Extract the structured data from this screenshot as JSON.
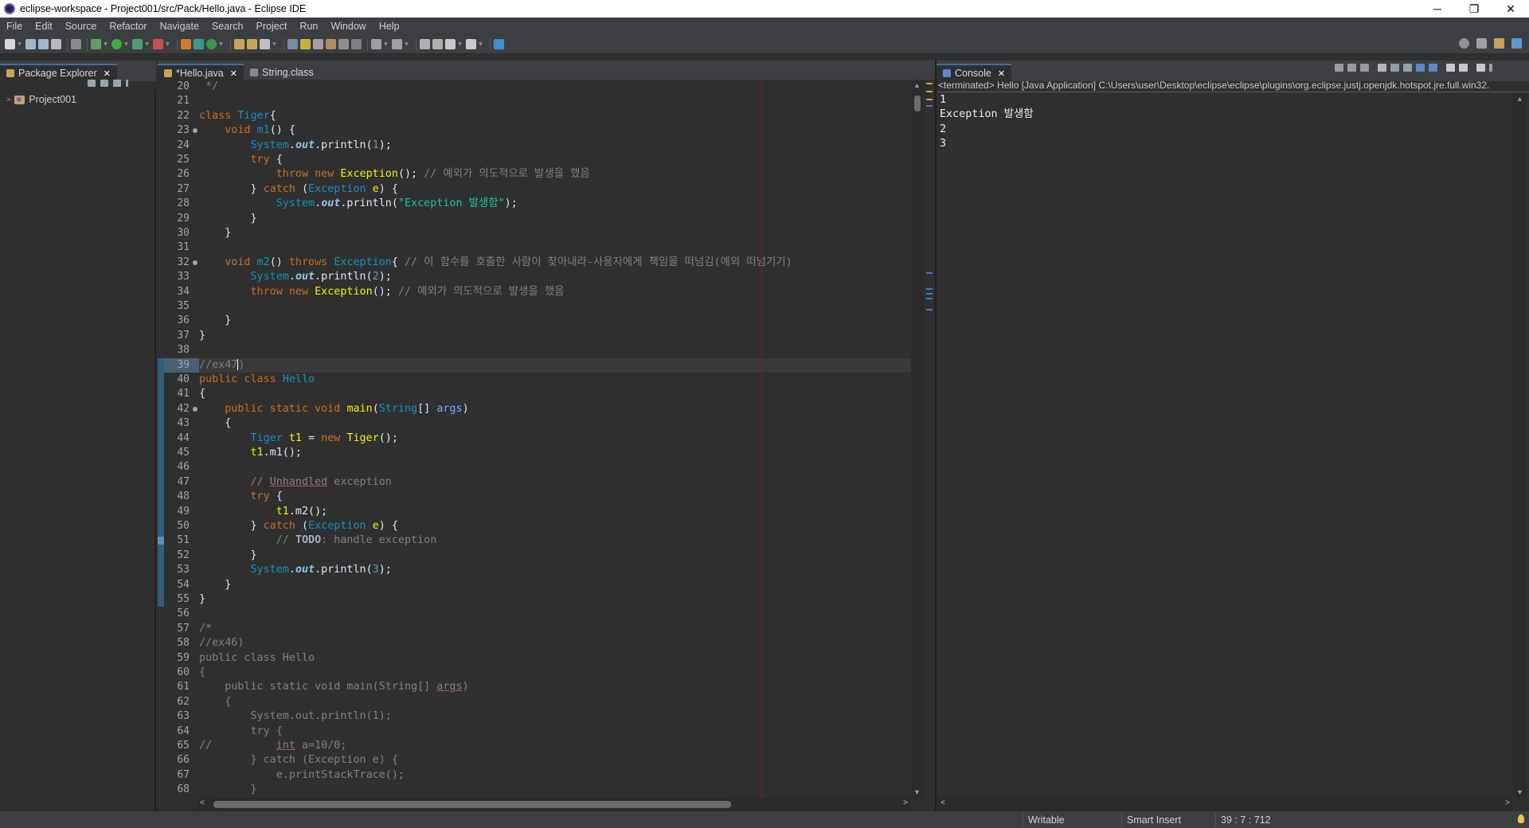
{
  "window": {
    "title": "eclipse-workspace - Project001/src/Pack/Hello.java - Eclipse IDE",
    "controls": {
      "minimize": "─",
      "restore": "❐",
      "close": "✕"
    }
  },
  "menu": [
    "File",
    "Edit",
    "Source",
    "Refactor",
    "Navigate",
    "Search",
    "Project",
    "Run",
    "Window",
    "Help"
  ],
  "package_explorer": {
    "tab_label": "Package Explorer",
    "project": "Project001"
  },
  "editor": {
    "tabs": [
      {
        "label": "*Hello.java",
        "active": true
      },
      {
        "label": "String.class",
        "active": false
      }
    ],
    "cursor_line": "39",
    "lines": [
      {
        "n": "20",
        "html": "<span class=\"cm\"> */</span>"
      },
      {
        "n": "21",
        "html": ""
      },
      {
        "n": "22",
        "html": "<span class=\"kw\">class</span> <span class=\"ty\">Tiger</span>{"
      },
      {
        "n": "23",
        "fold": true,
        "html": "    <span class=\"kw\">void</span> <span class=\"ty\">m1</span>() {"
      },
      {
        "n": "24",
        "html": "        <span class=\"ty\">System</span>.<span class=\"fld\">out</span>.println(<span class=\"num\">1</span>);"
      },
      {
        "n": "25",
        "html": "        <span class=\"kw\">try</span> {"
      },
      {
        "n": "26",
        "html": "            <span class=\"kw\">throw</span> <span class=\"kw\">new</span> <span class=\"var\">Exception</span>(); <span class=\"cm\">// 예외가 의도적으로 발생을 했음</span>"
      },
      {
        "n": "27",
        "html": "        } <span class=\"kw\">catch</span> (<span class=\"ty\">Exception</span> <span class=\"var\">e</span>) {"
      },
      {
        "n": "28",
        "html": "            <span class=\"ty\">System</span>.<span class=\"fld\">out</span>.println(<span class=\"str\">\"Exception 발생함\"</span>);"
      },
      {
        "n": "29",
        "html": "        }"
      },
      {
        "n": "30",
        "html": "    }"
      },
      {
        "n": "31",
        "html": ""
      },
      {
        "n": "32",
        "fold": true,
        "html": "    <span class=\"kw\">void</span> <span class=\"ty\">m2</span>() <span class=\"kw\">throws</span> <span class=\"ty\">Exception</span>{ <span class=\"cm\">// 이 함수를 호출한 사람이 찾아내라-사용자에게 책임을 떠넘김(예외 떠넘기기)</span>"
      },
      {
        "n": "33",
        "html": "        <span class=\"ty\">System</span>.<span class=\"fld\">out</span>.println(<span class=\"num\">2</span>);"
      },
      {
        "n": "34",
        "html": "        <span class=\"kw\">throw</span> <span class=\"kw\">new</span> <span class=\"var\">Exception</span>(); <span class=\"cm\">// 예외가 의도적으로 발생을 했음</span>"
      },
      {
        "n": "35",
        "html": ""
      },
      {
        "n": "36",
        "html": "    }"
      },
      {
        "n": "37",
        "html": "}"
      },
      {
        "n": "38",
        "html": ""
      },
      {
        "n": "39",
        "current": true,
        "html": "<span class=\"cm\">//ex47<span class=\"caret\"></span>)</span>"
      },
      {
        "n": "40",
        "html": "<span class=\"kw\">public</span> <span class=\"kw\">class</span> <span class=\"ty\">Hello</span>"
      },
      {
        "n": "41",
        "html": "{"
      },
      {
        "n": "42",
        "fold": true,
        "html": "    <span class=\"kw\">public</span> <span class=\"kw\">static</span> <span class=\"kw\">void</span> <span class=\"var\">main</span>(<span class=\"ty\">String</span>[] <span class=\"par\">args</span>)"
      },
      {
        "n": "43",
        "html": "    {"
      },
      {
        "n": "44",
        "html": "        <span class=\"ty\">Tiger</span> <span class=\"var\">t1</span> = <span class=\"kw\">new</span> <span class=\"var\">Tiger</span>();"
      },
      {
        "n": "45",
        "html": "        <span class=\"var\">t1</span>.m1();"
      },
      {
        "n": "46",
        "html": ""
      },
      {
        "n": "47",
        "html": "        <span class=\"cm\">// <span class=\"ul\">Unhandled</span> exception</span>"
      },
      {
        "n": "48",
        "html": "        <span class=\"kw\">try</span> {"
      },
      {
        "n": "49",
        "html": "            <span class=\"var\">t1</span>.m2();"
      },
      {
        "n": "50",
        "html": "        } <span class=\"kw\">catch</span> (<span class=\"ty\">Exception</span> <span class=\"var\">e</span>) {"
      },
      {
        "n": "51",
        "task": true,
        "html": "            <span class=\"cm\">// <span class=\"todo\">TODO</span>: handle exception</span>"
      },
      {
        "n": "52",
        "html": "        }"
      },
      {
        "n": "53",
        "html": "        <span class=\"ty\">System</span>.<span class=\"fld\">out</span>.println(<span class=\"num\">3</span>);"
      },
      {
        "n": "54",
        "html": "    }"
      },
      {
        "n": "55",
        "html": "}"
      },
      {
        "n": "56",
        "html": ""
      },
      {
        "n": "57",
        "html": "<span class=\"cm\">/*</span>"
      },
      {
        "n": "58",
        "html": "<span class=\"cm\">//ex46)</span>"
      },
      {
        "n": "59",
        "html": "<span class=\"cm\">public class Hello</span>"
      },
      {
        "n": "60",
        "html": "<span class=\"cm\">{</span>"
      },
      {
        "n": "61",
        "html": "<span class=\"cm\">    public static void main(String[] <span class=\"ul\">args</span>)</span>"
      },
      {
        "n": "62",
        "html": "<span class=\"cm\">    {</span>"
      },
      {
        "n": "63",
        "html": "<span class=\"cm\">        System.out.println(1);</span>"
      },
      {
        "n": "64",
        "html": "<span class=\"cm\">        try {</span>"
      },
      {
        "n": "65",
        "html": "<span class=\"cm\">//          <span class=\"ul\">int</span> a=10/0;</span>"
      },
      {
        "n": "66",
        "html": "<span class=\"cm\">        } catch (Exception e) {</span>"
      },
      {
        "n": "67",
        "html": "<span class=\"cm\">            e.printStackTrace();</span>"
      },
      {
        "n": "68",
        "html": "<span class=\"cm\">        }</span>"
      }
    ]
  },
  "console": {
    "tab_label": "Console",
    "header": "<terminated> Hello [Java Application] C:\\Users\\user\\Desktop\\eclipse\\eclipse\\plugins\\org.eclipse.justj.openjdk.hotspot.jre.full.win32.",
    "output": [
      "1",
      "Exception 발생함",
      "2",
      "3"
    ]
  },
  "status": {
    "writable": "Writable",
    "insert_mode": "Smart Insert",
    "position": "39 : 7 : 712"
  },
  "colors": {
    "background": "#2f2f2f",
    "chrome": "#3c3f41",
    "keyword": "#cc6c1d",
    "type": "#1290c3",
    "string": "#17c6a3",
    "comment": "#808080",
    "print_margin": "#8b1c1c"
  }
}
